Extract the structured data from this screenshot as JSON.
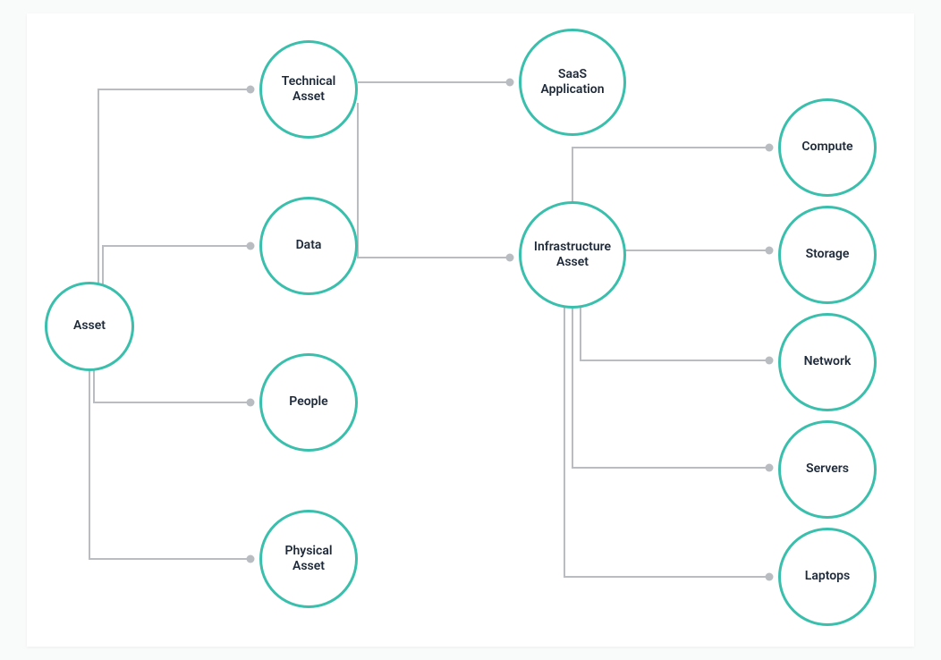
{
  "diagram": {
    "colors": {
      "node_border": "#3bbfad",
      "connector": "#b9bdc1",
      "dot": "#b9bdc1",
      "bg": "#ffffff",
      "page_bg": "#f9fafa"
    },
    "nodes": {
      "asset": {
        "label": "Asset"
      },
      "technical_asset": {
        "label": "Technical\nAsset"
      },
      "data": {
        "label": "Data"
      },
      "people": {
        "label": "People"
      },
      "physical_asset": {
        "label": "Physical\nAsset"
      },
      "saas_application": {
        "label": "SaaS\nApplication"
      },
      "infrastructure_asset": {
        "label": "Infrastructure\nAsset"
      },
      "compute": {
        "label": "Compute"
      },
      "storage": {
        "label": "Storage"
      },
      "network": {
        "label": "Network"
      },
      "servers": {
        "label": "Servers"
      },
      "laptops": {
        "label": "Laptops"
      }
    }
  }
}
